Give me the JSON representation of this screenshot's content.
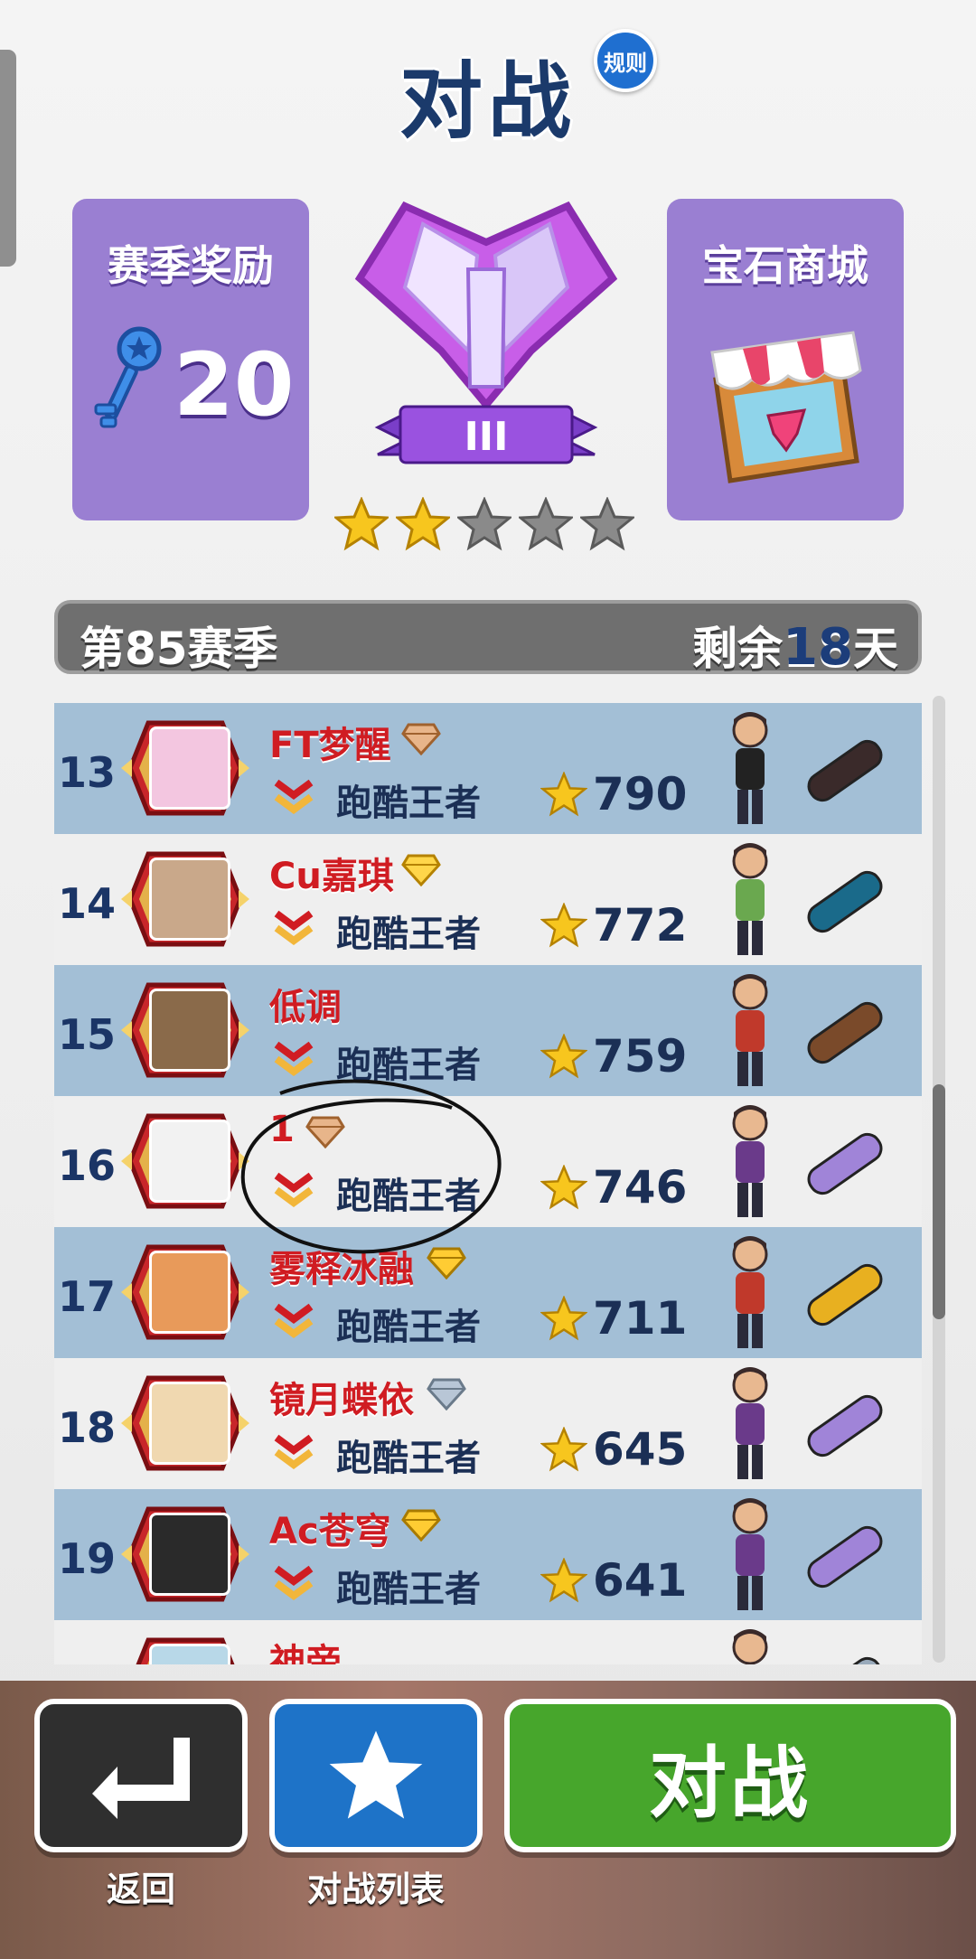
{
  "header": {
    "title": "对战",
    "rules_label": "规则"
  },
  "season_rewards": {
    "title": "赛季奖励",
    "key_count": "20",
    "icon": "key-icon"
  },
  "gem_shop": {
    "title": "宝石商城",
    "icon": "gem-shop-icon"
  },
  "league": {
    "icon": "amethyst-league-badge-icon",
    "tier_numeral": "III",
    "stars_filled": 2,
    "stars_total": 5
  },
  "season": {
    "label": "第85赛季",
    "remaining_prefix": "剩余",
    "remaining_days": "18",
    "remaining_suffix": "天"
  },
  "leaderboard": [
    {
      "rank": "13",
      "name": "FT梦醒",
      "gem": "bronze",
      "title": "跑酷王者",
      "score": "790"
    },
    {
      "rank": "14",
      "name": "Cu嘉琪",
      "gem": "gold",
      "title": "跑酷王者",
      "score": "772"
    },
    {
      "rank": "15",
      "name": "低调",
      "gem": "",
      "title": "跑酷王者",
      "score": "759"
    },
    {
      "rank": "16",
      "name": "1",
      "gem": "bronze",
      "title": "跑酷王者",
      "score": "746"
    },
    {
      "rank": "17",
      "name": "雾释冰融",
      "gem": "gold-laurel",
      "title": "跑酷王者",
      "score": "711"
    },
    {
      "rank": "18",
      "name": "镜月蝶依",
      "gem": "silver",
      "title": "跑酷王者",
      "score": "645"
    },
    {
      "rank": "19",
      "name": "Ac苍穹",
      "gem": "gold-laurel",
      "title": "跑酷王者",
      "score": "641"
    },
    {
      "rank": "",
      "name": "神帝",
      "gem": "",
      "title": "",
      "score": ""
    }
  ],
  "bottom": {
    "back_label": "返回",
    "list_label": "对战列表",
    "battle_label": "对战"
  },
  "colors": {
    "accent_purple": "#9a7fd2",
    "name_red": "#d01c22",
    "battle_green": "#47a62c",
    "list_blue": "#1e73c8"
  }
}
